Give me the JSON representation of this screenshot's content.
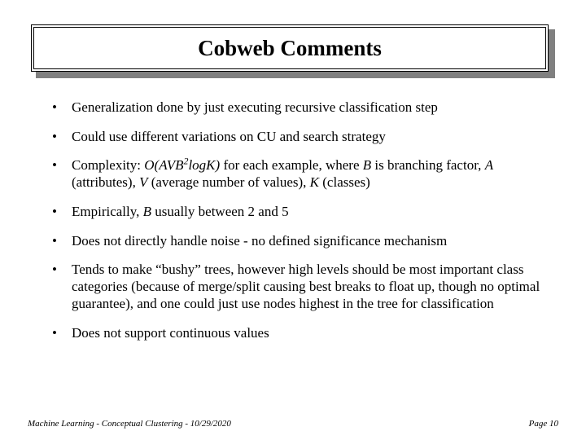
{
  "title": "Cobweb Comments",
  "bullets": {
    "b0": "Generalization done by just executing recursive classification step",
    "b1": "Could use different variations on CU and search strategy",
    "b2_pre": "Complexity: ",
    "b2_complexity": "O(AVB",
    "b2_sup": "2",
    "b2_complexity2": "logK)",
    "b2_mid1": " for each example, where ",
    "b2_B": "B",
    "b2_mid2": " is branching factor, ",
    "b2_A": "A",
    "b2_mid3": " (attributes), ",
    "b2_V": "V",
    "b2_mid4": " (average number of values), ",
    "b2_K": "K",
    "b2_mid5": " (classes)",
    "b3_pre": "Empirically, ",
    "b3_B": "B",
    "b3_post": " usually between 2 and 5",
    "b4": "Does not directly handle noise - no defined significance mechanism",
    "b5": "Tends to make “bushy” trees, however high levels should be most important class categories (because of merge/split causing best breaks to float up, though no optimal guarantee), and one could just use nodes highest in the tree for classification",
    "b6": "Does not support continuous values"
  },
  "footer": {
    "left": "Machine Learning -  Conceptual Clustering - 10/29/2020",
    "right": "Page 10"
  }
}
